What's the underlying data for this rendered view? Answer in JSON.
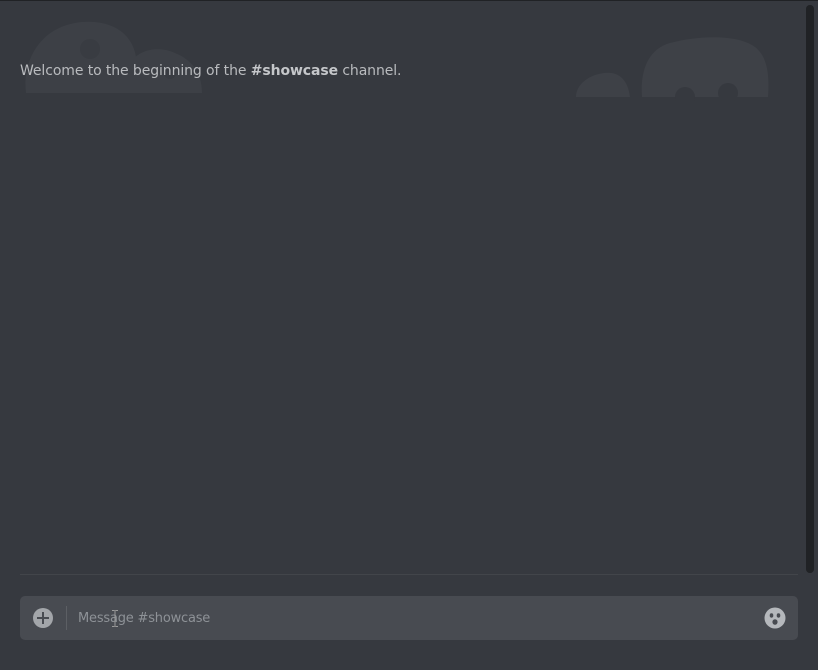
{
  "channel": {
    "name": "#showcase"
  },
  "welcome": {
    "prefix": "Welcome to the beginning of the ",
    "channel_name": "#showcase",
    "suffix": " channel."
  },
  "composer": {
    "placeholder": "Message #showcase",
    "value": "",
    "upload_icon": "plus-circle-icon",
    "emoji_icon": "emoji-face-icon"
  },
  "colors": {
    "background": "#36393f",
    "composer_background": "#484b51",
    "text_muted": "#b9bbbe",
    "icon": "#a3a6aa"
  }
}
